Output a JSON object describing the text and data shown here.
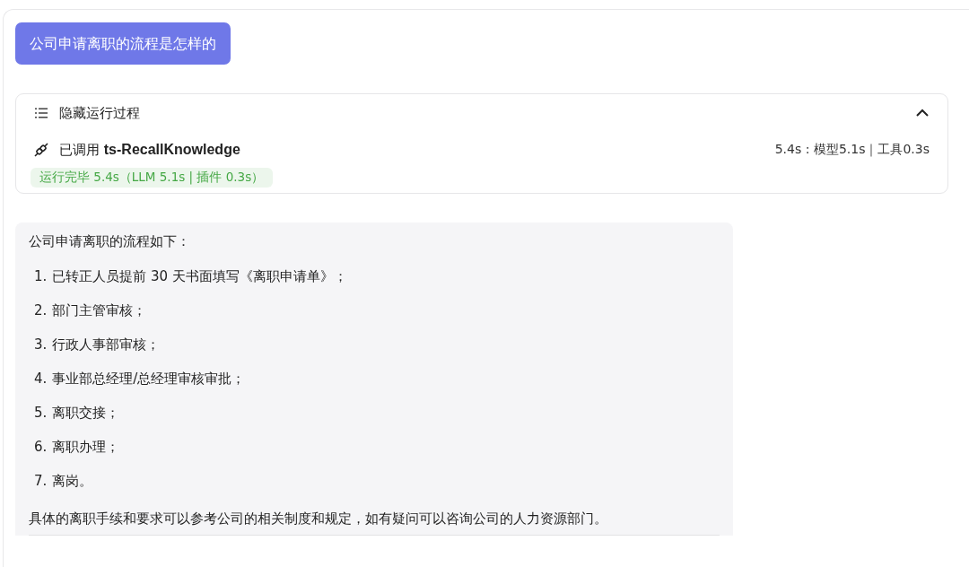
{
  "question": "公司申请离职的流程是怎样的",
  "process": {
    "toggle_label": "隐藏运行过程",
    "expanded": true,
    "call_prefix": "已调用",
    "tool_name": "ts-RecallKnowledge",
    "timing": "5.4s : 模型5.1s｜工具0.3s",
    "status": "运行完毕 5.4s（LLM 5.1s | 插件 0.3s）"
  },
  "answer": {
    "intro": "公司申请离职的流程如下：",
    "steps": [
      {
        "number": "1.",
        "text": "已转正人员提前 30 天书面填写《离职申请单》；"
      },
      {
        "number": "2.",
        "text": "部门主管审核；"
      },
      {
        "number": "3.",
        "text": "行政人事部审核；"
      },
      {
        "number": "4.",
        "text": "事业部总经理/总经理审核审批；"
      },
      {
        "number": "5.",
        "text": "离职交接；"
      },
      {
        "number": "6.",
        "text": "离职办理；"
      },
      {
        "number": "7.",
        "text": "离岗。"
      }
    ],
    "closing": "具体的离职手续和要求可以参考公司的相关制度和规定，如有疑问可以咨询公司的人力资源部门。"
  }
}
